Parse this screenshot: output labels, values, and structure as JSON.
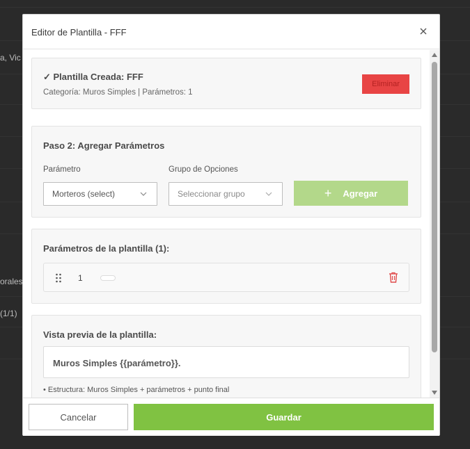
{
  "background": {
    "fragments": [
      "a, Vic",
      "orales",
      "(1/1)"
    ]
  },
  "modal": {
    "title": "Editor de Plantilla - FFF"
  },
  "created": {
    "title": "✓ Plantilla Creada: FFF",
    "meta": "Categoría: Muros Simples | Parámetros: 1",
    "delete_label": "Eliminar"
  },
  "step2": {
    "title": "Paso 2: Agregar Parámetros",
    "param_label": "Parámetro",
    "param_value": "Morteros (select)",
    "group_label": "Grupo de Opciones",
    "group_placeholder": "Seleccionar grupo",
    "add_label": "Agregar"
  },
  "params": {
    "title": "Parámetros de la plantilla (1):",
    "items": [
      {
        "number": "1"
      }
    ]
  },
  "preview": {
    "title": "Vista previa de la plantilla:",
    "text": "Muros Simples {{parámetro}}.",
    "note": "• Estructura: Muros Simples + parámetros + punto final"
  },
  "footer": {
    "cancel_label": "Cancelar",
    "save_label": "Guardar"
  },
  "colors": {
    "primary_green": "#80c242",
    "disabled_green": "#b3d88a",
    "danger_red": "#e84444"
  },
  "icons": {
    "close": "close-icon",
    "caret": "chevron-down-icon",
    "plus": "plus-icon",
    "drag": "drag-handle-icon",
    "trash": "trash-icon"
  }
}
